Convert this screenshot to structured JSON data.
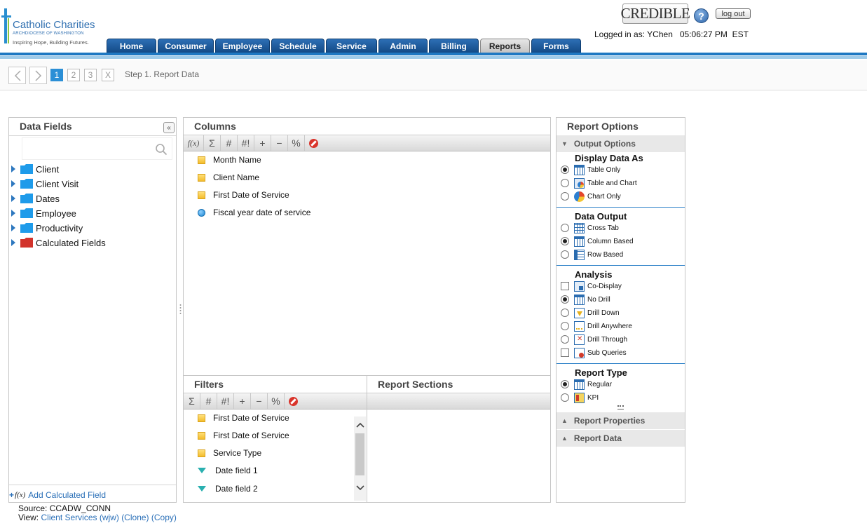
{
  "header": {
    "org_name": "Catholic Charities",
    "org_subtitle": "ARCHDIOCESE OF WASHINGTON",
    "org_tagline": "Inspiring Hope, Building Futures.",
    "product_logo": "CREDIBLE",
    "help_label": "?",
    "logout_label": "log out",
    "login_info": "Logged in as: YChen   05:06:27 PM  EST"
  },
  "nav": {
    "tabs": [
      {
        "label": "Home"
      },
      {
        "label": "Consumer"
      },
      {
        "label": "Employee"
      },
      {
        "label": "Schedule"
      },
      {
        "label": "Service"
      },
      {
        "label": "Admin"
      },
      {
        "label": "Billing"
      },
      {
        "label": "Reports"
      },
      {
        "label": "Forms"
      }
    ],
    "active": "Reports"
  },
  "steps": {
    "items": [
      "1",
      "2",
      "3",
      "X"
    ],
    "active": "1",
    "label": "Step 1. Report Data"
  },
  "data_fields": {
    "title": "Data Fields",
    "collapse_label": "«",
    "search_placeholder": "",
    "tree": [
      {
        "label": "Client",
        "color": "#1e9bea"
      },
      {
        "label": "Client Visit",
        "color": "#1e9bea"
      },
      {
        "label": "Dates",
        "color": "#1e9bea"
      },
      {
        "label": "Employee",
        "color": "#1e9bea"
      },
      {
        "label": "Productivity",
        "color": "#1e9bea"
      },
      {
        "label": "Calculated Fields",
        "color": "#d2332b"
      }
    ],
    "add_calculated": "Add Calculated Field",
    "fx_label": "f(x)"
  },
  "columns": {
    "title": "Columns",
    "toolbar": [
      "f(x)",
      "Σ",
      "#",
      "#!",
      "+",
      "−",
      "%"
    ],
    "fields": [
      {
        "label": "Month Name",
        "icon": "square"
      },
      {
        "label": "Client Name",
        "icon": "square"
      },
      {
        "label": "First Date of Service",
        "icon": "square"
      },
      {
        "label": "Fiscal year date of service",
        "icon": "dot"
      }
    ]
  },
  "filters": {
    "title": "Filters",
    "toolbar": [
      "Σ",
      "#",
      "#!",
      "+",
      "−",
      "%"
    ],
    "fields": [
      {
        "label": "First Date of Service",
        "icon": "square"
      },
      {
        "label": "First Date of Service",
        "icon": "square"
      },
      {
        "label": "Service Type",
        "icon": "square"
      },
      {
        "label": "Date field 1",
        "icon": "funnel"
      },
      {
        "label": "Date field 2",
        "icon": "funnel"
      }
    ]
  },
  "report_sections": {
    "title": "Report Sections"
  },
  "report_options": {
    "title": "Report Options",
    "output_options_label": "Output Options",
    "display_data_as": {
      "title": "Display Data As",
      "options": [
        {
          "label": "Table Only",
          "checked": true
        },
        {
          "label": "Table and Chart",
          "checked": false
        },
        {
          "label": "Chart Only",
          "checked": false
        }
      ]
    },
    "data_output": {
      "title": "Data Output",
      "options": [
        {
          "label": "Cross Tab",
          "checked": false
        },
        {
          "label": "Column Based",
          "checked": true
        },
        {
          "label": "Row Based",
          "checked": false
        }
      ]
    },
    "analysis": {
      "title": "Analysis",
      "options": [
        {
          "label": "Co-Display",
          "checked": false,
          "control": "checkbox"
        },
        {
          "label": "No Drill",
          "checked": true,
          "control": "radio"
        },
        {
          "label": "Drill Down",
          "checked": false,
          "control": "radio"
        },
        {
          "label": "Drill Anywhere",
          "checked": false,
          "control": "radio"
        },
        {
          "label": "Drill Through",
          "checked": false,
          "control": "radio"
        },
        {
          "label": "Sub Queries",
          "checked": false,
          "control": "checkbox"
        }
      ]
    },
    "report_type": {
      "title": "Report Type",
      "options": [
        {
          "label": "Regular",
          "checked": true
        },
        {
          "label": "KPI",
          "checked": false
        }
      ]
    },
    "report_properties_label": "Report Properties",
    "report_data_label": "Report Data"
  },
  "footer": {
    "source": "Source: CCADW_CONN",
    "view_prefix": "View:",
    "view_link": "Client Services (wjw)",
    "clone_link": "(Clone)",
    "copy_link": "(Copy)"
  },
  "colors": {
    "accent": "#1e78c2",
    "nav_tab": "#134a86",
    "active_step": "#2b8fd6",
    "link": "#2b70b8"
  }
}
